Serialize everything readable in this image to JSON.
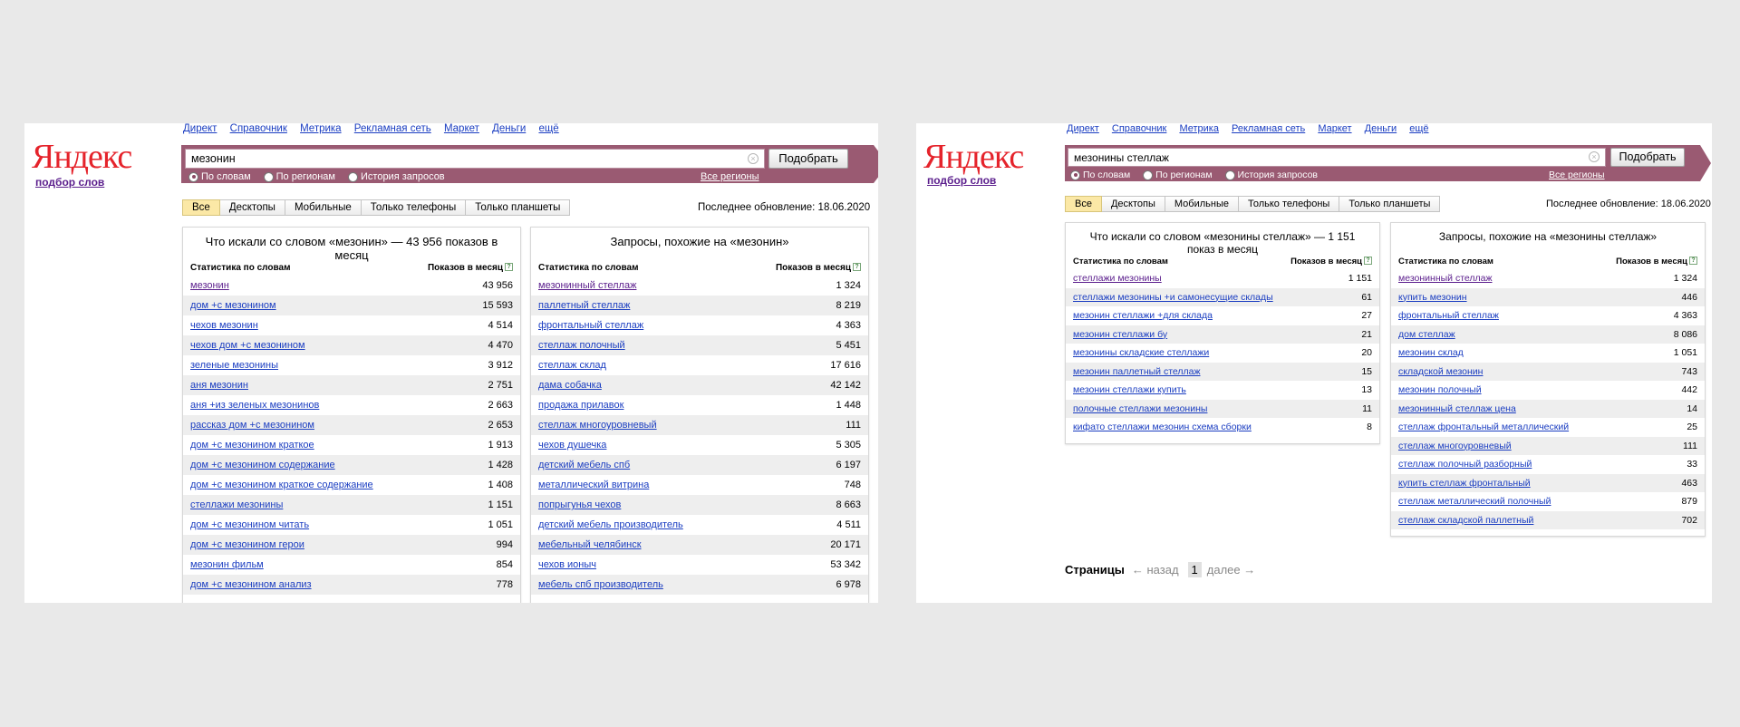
{
  "left": {
    "logo": "Яндекс",
    "logo_sub": "подбор слов",
    "nav": [
      "Директ",
      "Справочник",
      "Метрика",
      "Рекламная сеть",
      "Маркет",
      "Деньги",
      "ещё"
    ],
    "search_value": "мезонин",
    "find_button": "Подобрать",
    "radios": [
      "По словам",
      "По регионам",
      "История запросов"
    ],
    "all_regions": "Все регионы",
    "tabs": [
      "Все",
      "Десктопы",
      "Мобильные",
      "Только телефоны",
      "Только планшеты"
    ],
    "updated": "Последнее обновление: 18.06.2020",
    "words": {
      "title": "Что искали со словом «мезонин» — 43 956 показов в месяц",
      "col1": "Статистика по словам",
      "col2": "Показов в месяц",
      "rows": [
        {
          "q": "мезонин",
          "n": "43 956"
        },
        {
          "q": "дом +с мезонином",
          "n": "15 593"
        },
        {
          "q": "чехов мезонин",
          "n": "4 514"
        },
        {
          "q": "чехов дом +с мезонином",
          "n": "4 470"
        },
        {
          "q": "зеленые мезонины",
          "n": "3 912"
        },
        {
          "q": "аня мезонин",
          "n": "2 751"
        },
        {
          "q": "аня +из зеленых мезонинов",
          "n": "2 663"
        },
        {
          "q": "рассказ дом +с мезонином",
          "n": "2 653"
        },
        {
          "q": "дом +с мезонином краткое",
          "n": "1 913"
        },
        {
          "q": "дом +с мезонином содержание",
          "n": "1 428"
        },
        {
          "q": "дом +с мезонином краткое содержание",
          "n": "1 408"
        },
        {
          "q": "стеллажи мезонины",
          "n": "1 151"
        },
        {
          "q": "дом +с мезонином читать",
          "n": "1 051"
        },
        {
          "q": "дом +с мезонином герои",
          "n": "994"
        },
        {
          "q": "мезонин фильм",
          "n": "854"
        },
        {
          "q": "дом +с мезонином анализ",
          "n": "778"
        }
      ]
    },
    "similar": {
      "title": "Запросы, похожие на «мезонин»",
      "col1": "Статистика по словам",
      "col2": "Показов в месяц",
      "rows": [
        {
          "q": "мезонинный стеллаж",
          "n": "1 324"
        },
        {
          "q": "паллетный стеллаж",
          "n": "8 219"
        },
        {
          "q": "фронтальный стеллаж",
          "n": "4 363"
        },
        {
          "q": "стеллаж полочный",
          "n": "5 451"
        },
        {
          "q": "стеллаж склад",
          "n": "17 616"
        },
        {
          "q": "дама собачка",
          "n": "42 142"
        },
        {
          "q": "продажа прилавок",
          "n": "1 448"
        },
        {
          "q": "стеллаж многоуровневый",
          "n": "111"
        },
        {
          "q": "чехов душечка",
          "n": "5 305"
        },
        {
          "q": "детский мебель спб",
          "n": "6 197"
        },
        {
          "q": "металлический витрина",
          "n": "748"
        },
        {
          "q": "попрыгунья чехов",
          "n": "8 663"
        },
        {
          "q": "детский мебель производитель",
          "n": "4 511"
        },
        {
          "q": "мебельный челябинск",
          "n": "20 171"
        },
        {
          "q": "чехов ионыч",
          "n": "53 342"
        },
        {
          "q": "мебель спб производитель",
          "n": "6 978"
        }
      ]
    }
  },
  "right": {
    "logo": "Яндекс",
    "logo_sub": "подбор слов",
    "nav": [
      "Директ",
      "Справочник",
      "Метрика",
      "Рекламная сеть",
      "Маркет",
      "Деньги",
      "ещё"
    ],
    "search_value": "мезонины стеллаж",
    "find_button": "Подобрать",
    "radios": [
      "По словам",
      "По регионам",
      "История запросов"
    ],
    "all_regions": "Все регионы",
    "tabs": [
      "Все",
      "Десктопы",
      "Мобильные",
      "Только телефоны",
      "Только планшеты"
    ],
    "updated": "Последнее обновление: 18.06.2020",
    "words": {
      "title": "Что искали со словом «мезонины стеллаж» — 1 151 показ в месяц",
      "col1": "Статистика по словам",
      "col2": "Показов в месяц",
      "rows": [
        {
          "q": "стеллажи мезонины",
          "n": "1 151"
        },
        {
          "q": "стеллажи мезонины +и самонесущие склады",
          "n": "61"
        },
        {
          "q": "мезонин стеллажи +для склада",
          "n": "27"
        },
        {
          "q": "мезонин стеллажи бу",
          "n": "21"
        },
        {
          "q": "мезонины складские стеллажи",
          "n": "20"
        },
        {
          "q": "мезонин паллетный стеллаж",
          "n": "15"
        },
        {
          "q": "мезонин стеллажи купить",
          "n": "13"
        },
        {
          "q": "полочные стеллажи мезонины",
          "n": "11"
        },
        {
          "q": "кифато стеллажи мезонин схема сборки",
          "n": "8"
        }
      ]
    },
    "similar": {
      "title": "Запросы, похожие на «мезонины стеллаж»",
      "col1": "Статистика по словам",
      "col2": "Показов в месяц",
      "rows": [
        {
          "q": "мезонинный стеллаж",
          "n": "1 324"
        },
        {
          "q": "купить мезонин",
          "n": "446"
        },
        {
          "q": "фронтальный стеллаж",
          "n": "4 363"
        },
        {
          "q": "дом стеллаж",
          "n": "8 086"
        },
        {
          "q": "мезонин склад",
          "n": "1 051"
        },
        {
          "q": "складской мезонин",
          "n": "743"
        },
        {
          "q": "мезонин полочный",
          "n": "442"
        },
        {
          "q": "мезонинный стеллаж цена",
          "n": "14"
        },
        {
          "q": "стеллаж фронтальный металлический",
          "n": "25"
        },
        {
          "q": "стеллаж многоуровневый",
          "n": "111"
        },
        {
          "q": "стеллаж полочный разборный",
          "n": "33"
        },
        {
          "q": "купить стеллаж фронтальный",
          "n": "463"
        },
        {
          "q": "стеллаж металлический полочный",
          "n": "879"
        },
        {
          "q": "стеллаж складской паллетный",
          "n": "702"
        }
      ]
    },
    "pager": {
      "label": "Страницы",
      "prev": "← назад",
      "current": "1",
      "next": "далее →"
    }
  }
}
